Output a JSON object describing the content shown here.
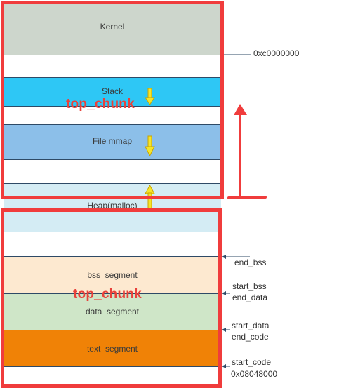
{
  "segments": {
    "kernel": {
      "label": "Kernel",
      "color": "#cdd6cc"
    },
    "stack": {
      "label": "Stack",
      "color": "#2ec7f5"
    },
    "file_mmap": {
      "label": "File mmap",
      "color": "#8cbfe9"
    },
    "heap": {
      "label": "Heap(malloc)",
      "color": "#d4ecf4"
    },
    "bss": {
      "label": "bss  segment",
      "color": "#fde9d0"
    },
    "data": {
      "label": "data  segment",
      "color": "#cfe6c8"
    },
    "text": {
      "label": "text  segment",
      "color": "#f08206"
    }
  },
  "overlay_labels": {
    "upper": "top_chunk",
    "lower": "top_chunk"
  },
  "address_labels": {
    "kernel_start": "0xc0000000",
    "end_bss": "end_bss",
    "start_bss": "start_bss",
    "end_data": "end_data",
    "start_data": "start_data",
    "end_code": "end_code",
    "start_code": "start_code",
    "text_base": "0x08048000"
  },
  "colors": {
    "highlight_red": "#f03c3c",
    "arrow_yellow": "#f5e52a",
    "divider": "#2e4a66"
  }
}
